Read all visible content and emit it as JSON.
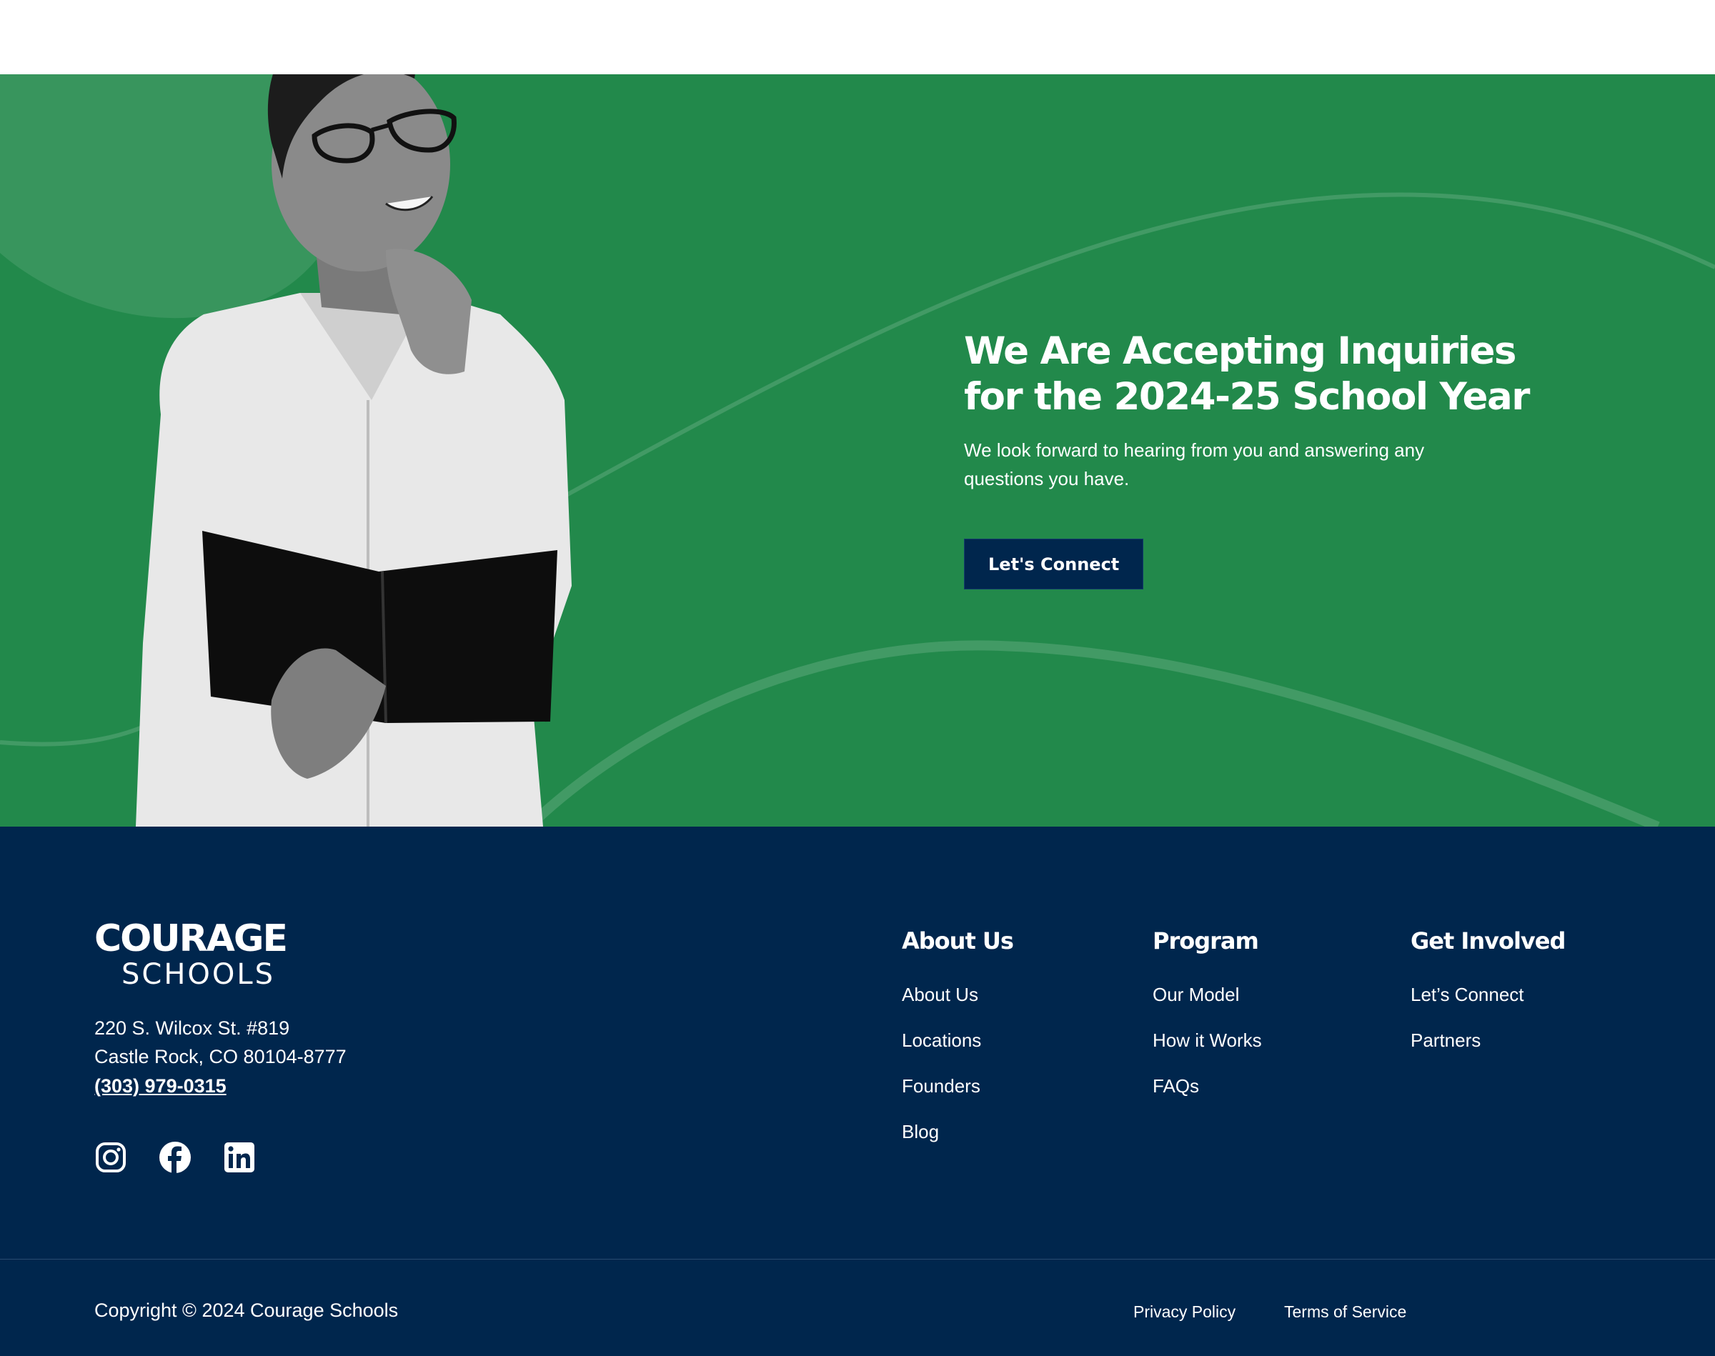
{
  "colors": {
    "hero_green": "#22894b",
    "footer_navy": "#00264d",
    "button_navy": "#00264d",
    "text_white": "#ffffff"
  },
  "hero": {
    "title_line1": "We Are Accepting Inquiries",
    "title_line2": "for the 2024-25 School Year",
    "subtitle": "We look forward to hearing from you and answering any questions you have.",
    "cta_label": "Let's Connect",
    "image_alt": "student-holding-book-photo"
  },
  "footer": {
    "logo": {
      "top": "COURAGE",
      "bottom": "SCHOOLS"
    },
    "address_line1": "220 S. Wilcox St. #819",
    "address_line2": "Castle Rock, CO 80104-8777",
    "phone": "(303) 979-0315",
    "socials": [
      {
        "icon": "instagram-icon"
      },
      {
        "icon": "facebook-icon"
      },
      {
        "icon": "linkedin-icon"
      }
    ],
    "columns": [
      {
        "title": "About Us",
        "items": [
          "About Us",
          "Locations",
          "Founders",
          "Blog"
        ]
      },
      {
        "title": "Program",
        "items": [
          "Our Model",
          "How it Works",
          "FAQs"
        ]
      },
      {
        "title": "Get Involved",
        "items": [
          "Let’s Connect",
          "Partners"
        ]
      }
    ],
    "copyright": "Copyright © 2024 Courage Schools",
    "privacy": "Privacy Policy",
    "terms": "Terms of Service"
  }
}
